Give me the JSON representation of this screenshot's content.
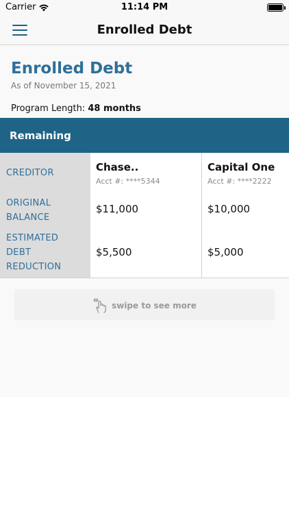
{
  "status_bar": {
    "carrier": "Carrier",
    "time": "11:14 PM",
    "icons": [
      "wifi-icon",
      "battery-icon"
    ]
  },
  "nav": {
    "title": "Enrolled Debt",
    "menu_icon": "hamburger-menu-icon"
  },
  "page": {
    "title": "Enrolled Debt",
    "as_of": "As of November 15, 2021",
    "program_length_label": "Program Length:",
    "program_length_value": "48 months"
  },
  "section": {
    "header": "Remaining"
  },
  "table": {
    "row_labels": {
      "creditor": [
        "CREDITOR"
      ],
      "original_balance": [
        "ORIGINAL",
        "BALANCE"
      ],
      "estimated_reduction": [
        "ESTIMATED",
        "DEBT",
        "REDUCTION"
      ]
    },
    "columns": [
      {
        "creditor": "Chase..",
        "acct": "Acct #: ****5344",
        "original_balance": "$11,000",
        "estimated_reduction": "$5,500"
      },
      {
        "creditor": "Capital One",
        "acct": "Acct #: ****2222",
        "original_balance": "$10,000",
        "estimated_reduction": "$5,000"
      }
    ]
  },
  "swipe_hint": {
    "text": "swipe to see more",
    "icon": "swipe-hand-icon"
  },
  "colors": {
    "accent": "#2e6f9a",
    "header_bar": "#1f6486",
    "label_column": "#dcdcdc"
  }
}
